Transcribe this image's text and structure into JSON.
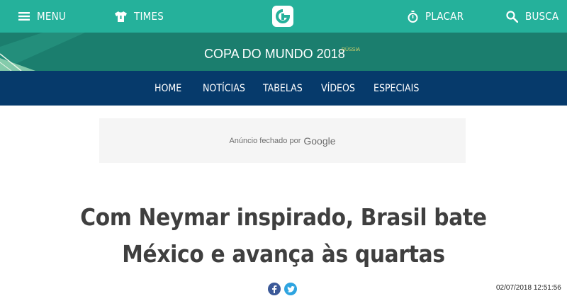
{
  "topbar": {
    "menu_label": "MENU",
    "times_label": "TIMES",
    "placar_label": "PLACAR",
    "busca_label": "BUSCA",
    "background_color": "#25b19b"
  },
  "copa": {
    "title": "COPA DO MUNDO 2018",
    "superscript": "RÚSSIA",
    "band_color": "#1b7e6e"
  },
  "section_nav": {
    "items": [
      {
        "label": "HOME"
      },
      {
        "label": "NOTÍCIAS"
      },
      {
        "label": "TABELAS"
      },
      {
        "label": "VÍDEOS"
      },
      {
        "label": "ESPECIAIS"
      }
    ],
    "background_color": "#063a6b"
  },
  "ad": {
    "text": "Anúncio fechado por",
    "brand": "Google"
  },
  "article": {
    "headline_line1": "Com Neymar inspirado, Brasil bate",
    "headline_line2": "México e avança às quartas",
    "timestamp": "02/07/2018 12:51:56"
  },
  "share": {
    "facebook_icon": "facebook-icon",
    "twitter_icon": "twitter-icon"
  }
}
